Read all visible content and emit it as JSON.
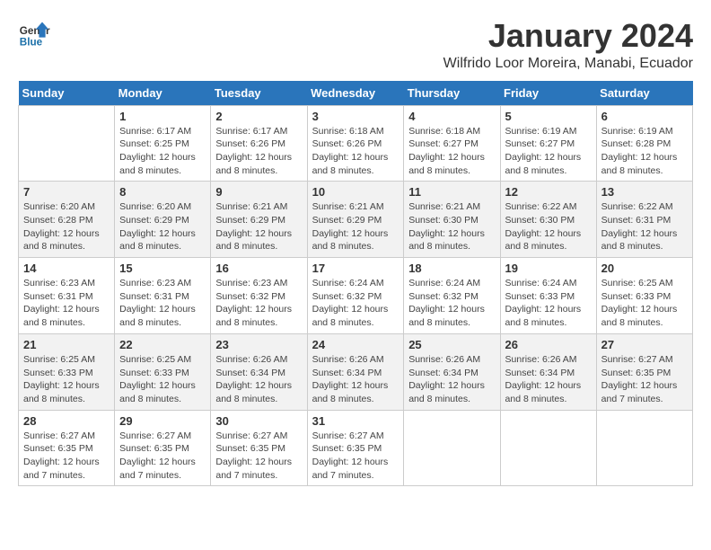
{
  "logo": {
    "line1": "General",
    "line2": "Blue"
  },
  "title": "January 2024",
  "subtitle": "Wilfrido Loor Moreira, Manabi, Ecuador",
  "days_of_week": [
    "Sunday",
    "Monday",
    "Tuesday",
    "Wednesday",
    "Thursday",
    "Friday",
    "Saturday"
  ],
  "weeks": [
    [
      {
        "day": "",
        "info": ""
      },
      {
        "day": "1",
        "info": "Sunrise: 6:17 AM\nSunset: 6:25 PM\nDaylight: 12 hours\nand 8 minutes."
      },
      {
        "day": "2",
        "info": "Sunrise: 6:17 AM\nSunset: 6:26 PM\nDaylight: 12 hours\nand 8 minutes."
      },
      {
        "day": "3",
        "info": "Sunrise: 6:18 AM\nSunset: 6:26 PM\nDaylight: 12 hours\nand 8 minutes."
      },
      {
        "day": "4",
        "info": "Sunrise: 6:18 AM\nSunset: 6:27 PM\nDaylight: 12 hours\nand 8 minutes."
      },
      {
        "day": "5",
        "info": "Sunrise: 6:19 AM\nSunset: 6:27 PM\nDaylight: 12 hours\nand 8 minutes."
      },
      {
        "day": "6",
        "info": "Sunrise: 6:19 AM\nSunset: 6:28 PM\nDaylight: 12 hours\nand 8 minutes."
      }
    ],
    [
      {
        "day": "7",
        "info": "Sunrise: 6:20 AM\nSunset: 6:28 PM\nDaylight: 12 hours\nand 8 minutes."
      },
      {
        "day": "8",
        "info": "Sunrise: 6:20 AM\nSunset: 6:29 PM\nDaylight: 12 hours\nand 8 minutes."
      },
      {
        "day": "9",
        "info": "Sunrise: 6:21 AM\nSunset: 6:29 PM\nDaylight: 12 hours\nand 8 minutes."
      },
      {
        "day": "10",
        "info": "Sunrise: 6:21 AM\nSunset: 6:29 PM\nDaylight: 12 hours\nand 8 minutes."
      },
      {
        "day": "11",
        "info": "Sunrise: 6:21 AM\nSunset: 6:30 PM\nDaylight: 12 hours\nand 8 minutes."
      },
      {
        "day": "12",
        "info": "Sunrise: 6:22 AM\nSunset: 6:30 PM\nDaylight: 12 hours\nand 8 minutes."
      },
      {
        "day": "13",
        "info": "Sunrise: 6:22 AM\nSunset: 6:31 PM\nDaylight: 12 hours\nand 8 minutes."
      }
    ],
    [
      {
        "day": "14",
        "info": "Sunrise: 6:23 AM\nSunset: 6:31 PM\nDaylight: 12 hours\nand 8 minutes."
      },
      {
        "day": "15",
        "info": "Sunrise: 6:23 AM\nSunset: 6:31 PM\nDaylight: 12 hours\nand 8 minutes."
      },
      {
        "day": "16",
        "info": "Sunrise: 6:23 AM\nSunset: 6:32 PM\nDaylight: 12 hours\nand 8 minutes."
      },
      {
        "day": "17",
        "info": "Sunrise: 6:24 AM\nSunset: 6:32 PM\nDaylight: 12 hours\nand 8 minutes."
      },
      {
        "day": "18",
        "info": "Sunrise: 6:24 AM\nSunset: 6:32 PM\nDaylight: 12 hours\nand 8 minutes."
      },
      {
        "day": "19",
        "info": "Sunrise: 6:24 AM\nSunset: 6:33 PM\nDaylight: 12 hours\nand 8 minutes."
      },
      {
        "day": "20",
        "info": "Sunrise: 6:25 AM\nSunset: 6:33 PM\nDaylight: 12 hours\nand 8 minutes."
      }
    ],
    [
      {
        "day": "21",
        "info": "Sunrise: 6:25 AM\nSunset: 6:33 PM\nDaylight: 12 hours\nand 8 minutes."
      },
      {
        "day": "22",
        "info": "Sunrise: 6:25 AM\nSunset: 6:33 PM\nDaylight: 12 hours\nand 8 minutes."
      },
      {
        "day": "23",
        "info": "Sunrise: 6:26 AM\nSunset: 6:34 PM\nDaylight: 12 hours\nand 8 minutes."
      },
      {
        "day": "24",
        "info": "Sunrise: 6:26 AM\nSunset: 6:34 PM\nDaylight: 12 hours\nand 8 minutes."
      },
      {
        "day": "25",
        "info": "Sunrise: 6:26 AM\nSunset: 6:34 PM\nDaylight: 12 hours\nand 8 minutes."
      },
      {
        "day": "26",
        "info": "Sunrise: 6:26 AM\nSunset: 6:34 PM\nDaylight: 12 hours\nand 8 minutes."
      },
      {
        "day": "27",
        "info": "Sunrise: 6:27 AM\nSunset: 6:35 PM\nDaylight: 12 hours\nand 7 minutes."
      }
    ],
    [
      {
        "day": "28",
        "info": "Sunrise: 6:27 AM\nSunset: 6:35 PM\nDaylight: 12 hours\nand 7 minutes."
      },
      {
        "day": "29",
        "info": "Sunrise: 6:27 AM\nSunset: 6:35 PM\nDaylight: 12 hours\nand 7 minutes."
      },
      {
        "day": "30",
        "info": "Sunrise: 6:27 AM\nSunset: 6:35 PM\nDaylight: 12 hours\nand 7 minutes."
      },
      {
        "day": "31",
        "info": "Sunrise: 6:27 AM\nSunset: 6:35 PM\nDaylight: 12 hours\nand 7 minutes."
      },
      {
        "day": "",
        "info": ""
      },
      {
        "day": "",
        "info": ""
      },
      {
        "day": "",
        "info": ""
      }
    ]
  ]
}
